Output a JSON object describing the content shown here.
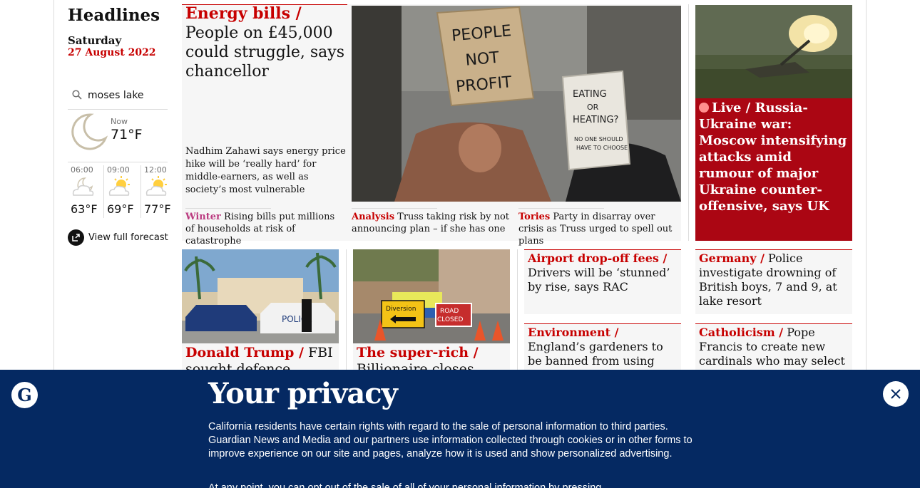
{
  "headlines": {
    "title": "Headlines",
    "day": "Saturday",
    "date": "27 August 2022"
  },
  "weather": {
    "location": "moses lake",
    "now_label": "Now",
    "now_temp": "71°F",
    "hours": [
      {
        "time": "06:00",
        "temp": "63°F",
        "icon": "cloud-night-icon"
      },
      {
        "time": "09:00",
        "temp": "69°F",
        "icon": "sun-cloud-icon"
      },
      {
        "time": "12:00",
        "temp": "77°F",
        "icon": "sun-cloud-icon"
      }
    ],
    "forecast_link": "View full forecast"
  },
  "lead": {
    "kicker": "Energy bills /",
    "headline": "People on £45,000 could struggle, says chancellor",
    "standfirst": "Nadhim Zahawi says energy price hike will be ‘really hard’ for middle-earners, as well as society’s most vulnerable",
    "subs": [
      {
        "kicker": "Winter",
        "text": "Rising bills put millions of households at risk of catastrophe"
      },
      {
        "kicker": "Analysis",
        "text": "Truss taking risk by not announcing plan – if she has one"
      },
      {
        "kicker": "Tories",
        "text": "Party in disarray over crisis as Truss urged to spell out plans"
      }
    ]
  },
  "live": {
    "kicker": "Live /",
    "headline": "Russia-Ukraine war: Moscow intensifying attacks amid rumour of major Ukraine counter-offensive, says UK"
  },
  "small_cards": [
    {
      "kicker": "Airport drop-off fees /",
      "text": "Drivers will be ‘stunned’ by rise, says RAC"
    },
    {
      "kicker": "Germany /",
      "text": "Police investigate drowning of British boys, 7 and 9, at lake resort"
    },
    {
      "kicker": "Environment /",
      "text": "England’s gardeners to be banned from using peat-based"
    },
    {
      "kicker": "Catholicism /",
      "text": "Pope Francis to create new cardinals who may select"
    }
  ],
  "photo_cards": [
    {
      "kicker": "Donald Trump /",
      "text": "FBI sought defence"
    },
    {
      "kicker": "The super-rich /",
      "text": "Billionaire closes main"
    }
  ],
  "privacy": {
    "title": "Your privacy",
    "body": "California residents have certain rights with regard to the sale of personal information to third parties. Guardian News and Media and our partners use information collected through cookies or in other forms to improve experience on our site and pages, analyze how it is used and show personalized advertising.",
    "body2": "At any point, you can opt out of the sale of all of your personal information by pressing"
  },
  "photo_signs": {
    "protest_left": "PEOPLE NOT PROFIT",
    "protest_right": "EATING OR HEATING?",
    "protest_right_small": "NO ONE SHOULD HAVE TO CHOOSE",
    "police": "POLICE",
    "diversion": "Diversion",
    "road_closed": "ROAD CLOSED"
  }
}
